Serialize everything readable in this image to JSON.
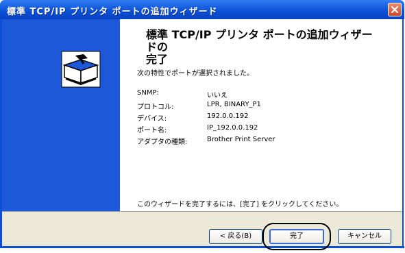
{
  "window": {
    "title": "標準 TCP/IP プリンタ ポートの追加ウィザード",
    "close_icon": "close-icon"
  },
  "sidebar": {
    "icon": "printer-wizard-icon"
  },
  "main": {
    "heading_line1": "標準 TCP/IP プリンタ ポートの追加ウィザードの",
    "heading_line2": "完了",
    "subtitle": "次の特性でポートが選択されました。",
    "properties": [
      {
        "label": "SNMP:",
        "value": "いいえ"
      },
      {
        "label": "プロトコル:",
        "value": "LPR, BINARY_P1"
      },
      {
        "label": "デバイス:",
        "value": "192.0.0.192"
      },
      {
        "label": "ポート名:",
        "value": "IP_192.0.0.192"
      },
      {
        "label": "アダプタの種類:",
        "value": "Brother Print Server"
      }
    ],
    "footer_text": "このウィザードを完了するには、[完了] をクリックしてください。"
  },
  "buttons": {
    "back": "< 戻る(B)",
    "finish": "完了",
    "cancel": "キャンセル"
  },
  "colors": {
    "titlebar": "#0a4fd6",
    "sidebar": "#1c58d8",
    "button_bar": "#ece9d8",
    "close_button": "#d2452a"
  }
}
